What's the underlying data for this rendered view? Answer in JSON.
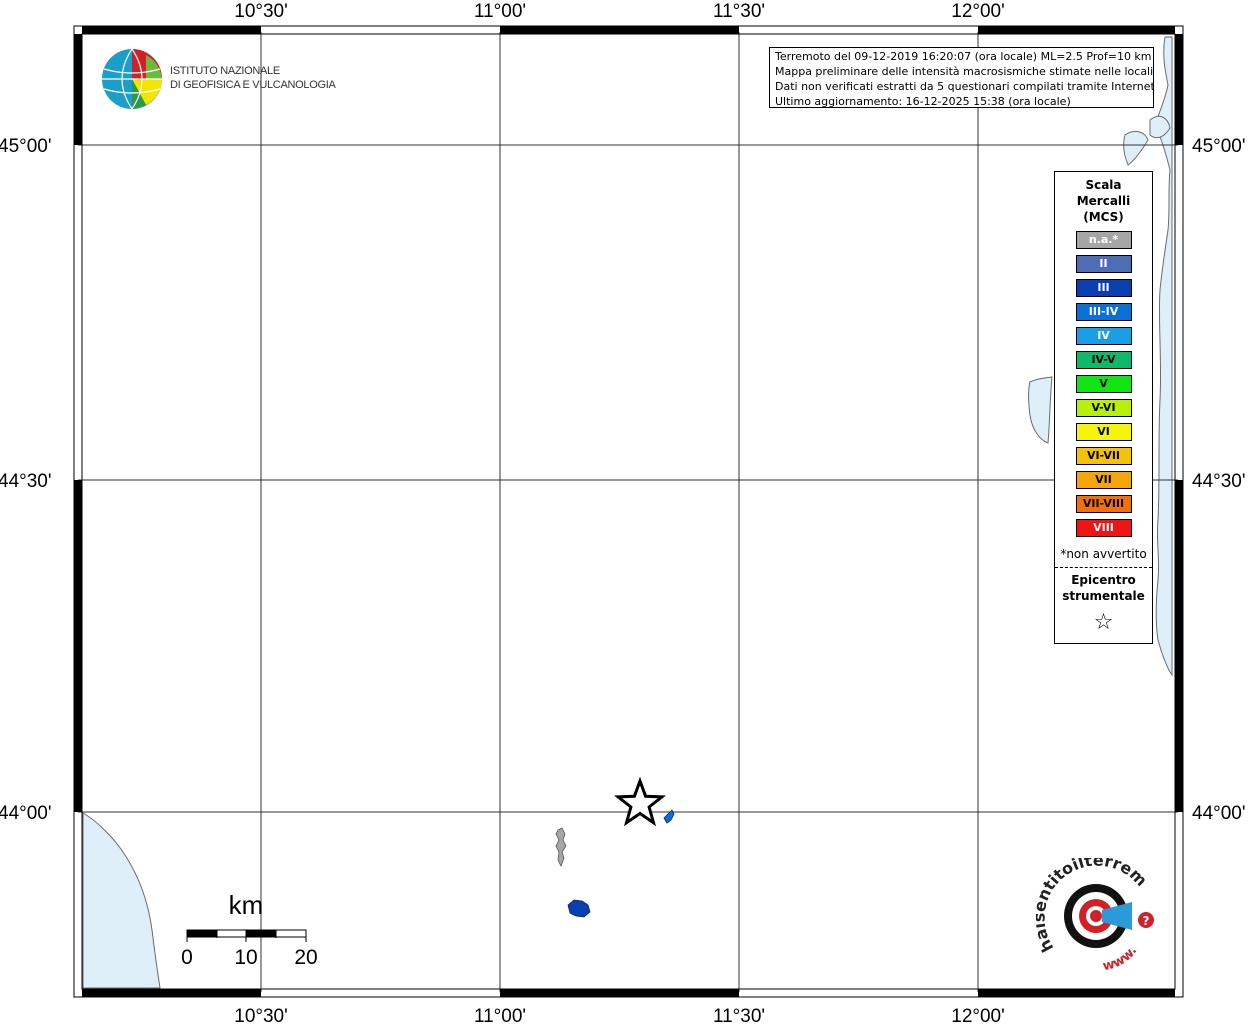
{
  "info_box": {
    "line1": "Terremoto del 09-12-2019 16:20:07 (ora locale) ML=2.5 Prof=10 km",
    "line2": "Mappa preliminare delle intensità macrosismiche stimate nelle località",
    "line3": "Dati non verificati estratti da 5 questionari compilati tramite Internet.",
    "line4": "Ultimo aggiornamento: 16-12-2025 15:38 (ora locale)"
  },
  "axes": {
    "top_labels": [
      "10°30'",
      "11°00'",
      "11°30'",
      "12°00'"
    ],
    "bottom_labels": [
      "10°30'",
      "11°00'",
      "11°30'",
      "12°00'"
    ],
    "left_labels": [
      "45°00'",
      "44°30'",
      "44°00'"
    ],
    "right_labels": [
      "45°00'",
      "44°30'",
      "44°00'"
    ]
  },
  "legend": {
    "title_line1": "Scala",
    "title_line2": "Mercalli",
    "title_line3": "(MCS)",
    "items": [
      {
        "label": "n.a.*",
        "color": "#a6a6a6",
        "text_color": "#ffffff"
      },
      {
        "label": "II",
        "color": "#4f6db5",
        "text_color": "#ffffff"
      },
      {
        "label": "III",
        "color": "#0a3fb0",
        "text_color": "#ffffff"
      },
      {
        "label": "III-IV",
        "color": "#0b6fd8",
        "text_color": "#ffffff"
      },
      {
        "label": "IV",
        "color": "#1a9fe6",
        "text_color": "#ffffff"
      },
      {
        "label": "IV-V",
        "color": "#10b86a",
        "text_color": "#000000"
      },
      {
        "label": "V",
        "color": "#11e614",
        "text_color": "#000000"
      },
      {
        "label": "V-VI",
        "color": "#b9f00a",
        "text_color": "#000000"
      },
      {
        "label": "VI",
        "color": "#f5f50a",
        "text_color": "#000000"
      },
      {
        "label": "VI-VII",
        "color": "#f5c20a",
        "text_color": "#000000"
      },
      {
        "label": "VII",
        "color": "#f5a40a",
        "text_color": "#000000"
      },
      {
        "label": "VII-VIII",
        "color": "#f2700a",
        "text_color": "#000000"
      },
      {
        "label": "VIII",
        "color": "#f01414",
        "text_color": "#ffffff"
      }
    ],
    "note": "*non avvertito",
    "epicenter_line1": "Epicentro",
    "epicenter_line2": "strumentale",
    "epicenter_symbol": "☆"
  },
  "ingv": {
    "line1": "ISTITUTO NAZIONALE",
    "line2": "DI GEOFISICA E VULCANOLOGIA"
  },
  "scale_bar": {
    "unit": "km",
    "labels": [
      "0",
      "10",
      "20"
    ]
  },
  "hsit": {
    "text": "haisentitoilterremoto.it",
    "www": "www.",
    "question": "?"
  },
  "colors": {
    "sea": "#dfeffa",
    "coast": "#6b6b6b",
    "frame": "#000000",
    "grid": "#333333"
  }
}
